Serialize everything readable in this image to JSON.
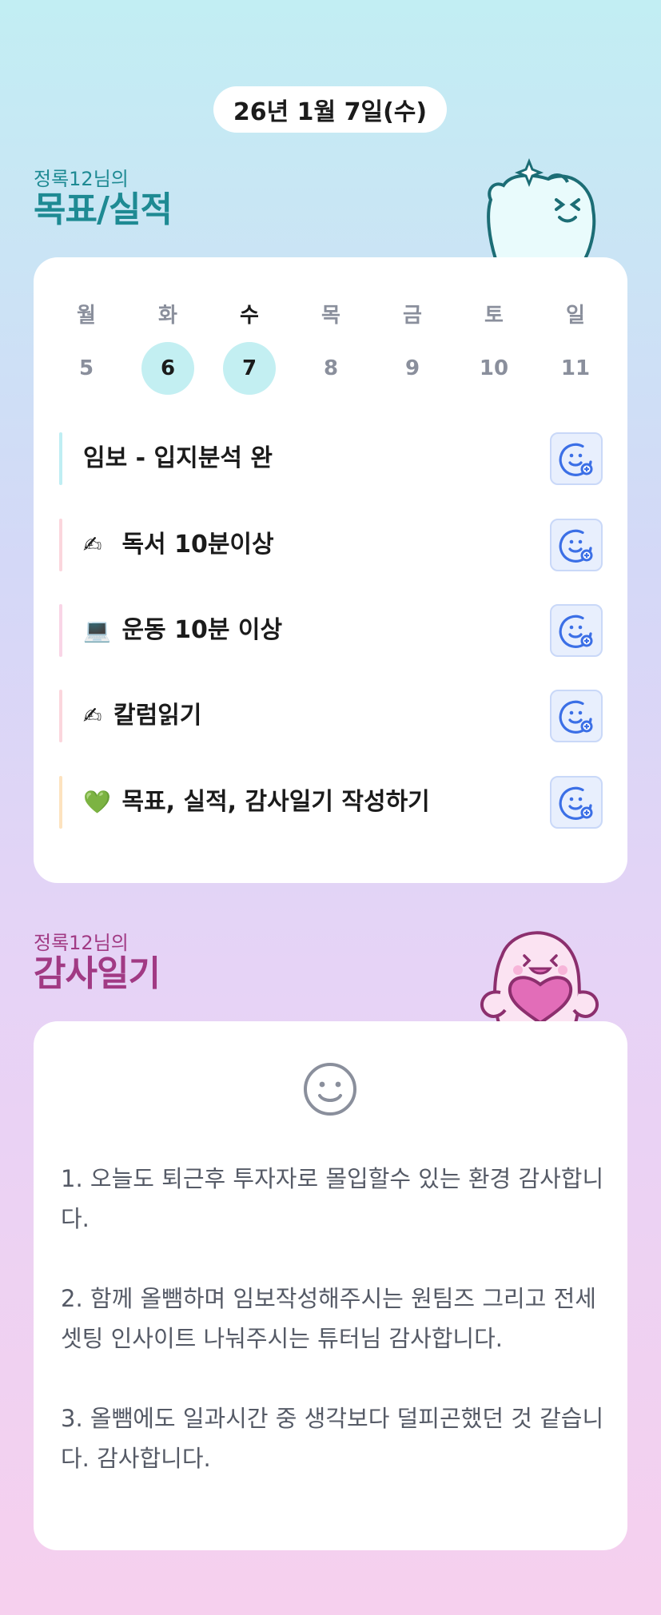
{
  "date_label": "26년 1월 7일(수)",
  "goals_section": {
    "owner": "정록12님의",
    "title": "목표/실적"
  },
  "week": [
    {
      "name": "월",
      "num": "5",
      "state": "none"
    },
    {
      "name": "화",
      "num": "6",
      "state": "filled"
    },
    {
      "name": "수",
      "num": "7",
      "state": "today"
    },
    {
      "name": "목",
      "num": "8",
      "state": "none"
    },
    {
      "name": "금",
      "num": "9",
      "state": "none"
    },
    {
      "name": "토",
      "num": "10",
      "state": "none"
    },
    {
      "name": "일",
      "num": "11",
      "state": "none"
    }
  ],
  "goals": [
    {
      "emoji": "",
      "text": "임보 - 입지분석 완",
      "bar_color": "#bfeef3"
    },
    {
      "emoji": "✍",
      "text": " 독서 10분이상",
      "bar_color": "#fbd6dd"
    },
    {
      "emoji": "💻",
      "text": " 운동 10분 이상",
      "bar_color": "#f9d5e6"
    },
    {
      "emoji": "✍",
      "text": "칼럼읽기",
      "bar_color": "#fbd6dd"
    },
    {
      "emoji": "💚",
      "text": " 목표, 실적, 감사일기 작성하기",
      "bar_color": "#fde3bf"
    }
  ],
  "thanks_section": {
    "owner": "정록12님의",
    "title": "감사일기"
  },
  "thanks_text": "1. 오늘도 퇴근후 투자자로 몰입할수 있는 환경 감사합니다.\n\n2. 함께 올뺌하며 임보작성해주시는 원팀즈 그리고 전세셋팅 인사이트 나눠주시는 튜터님 감사합니다.\n\n3. 올뺌에도 일과시간 중 생각보다 덜피곤했던 것 같습니다. 감사합니다.",
  "icons": {
    "reaction": "smile-plus-icon",
    "thanks_face": "smile-face-icon"
  },
  "colors": {
    "goals_heading": "#1e8a93",
    "thanks_heading": "#a13a84",
    "selected_day": "#c3eff2",
    "reaction_icon": "#3b6fe6"
  }
}
